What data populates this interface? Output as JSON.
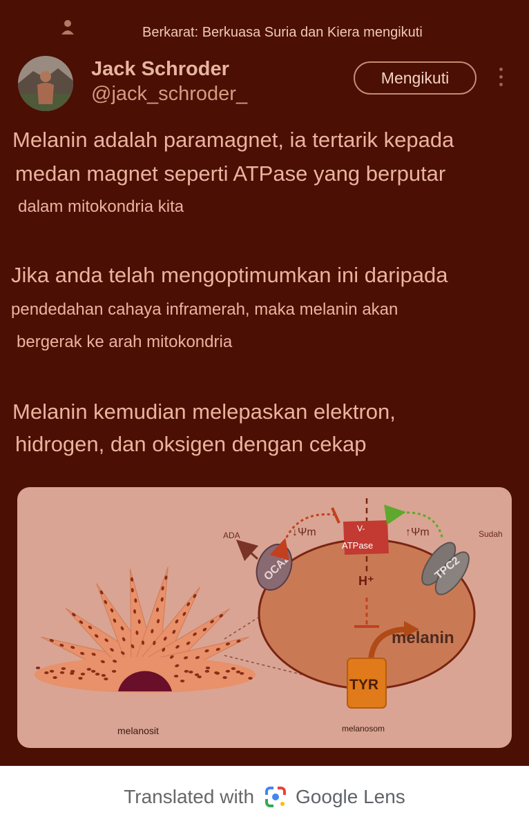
{
  "retweet": {
    "text": "Berkarat: Berkuasa Suria dan Kiera mengikuti"
  },
  "author": {
    "name": "Jack Schroder",
    "handle": "@jack_schroder_"
  },
  "follow_button": {
    "label": "Mengikuti"
  },
  "tweet": {
    "lines": [
      "Melanin adalah paramagnet, ia tertarik kepada",
      "medan magnet seperti ATPase yang berputar",
      "dalam mitokondria kita",
      "Jika anda telah mengoptimumkan ini daripada",
      "pendedahan cahaya inframerah, maka melanin akan",
      "bergerak ke arah mitokondria",
      "Melanin kemudian melepaskan elektron,",
      "hidrogen, dan oksigen dengan cekap"
    ]
  },
  "diagram": {
    "ada": "ADA",
    "sudah": "Sudah",
    "psi_left": "↓Ψm",
    "psi_right": "↑Ψm",
    "v_prefix": "V-",
    "atpase": "ATPase",
    "hplus": "H⁺",
    "oca2": "OCA2",
    "tpc2": "TPC2",
    "melanin": "melanin",
    "tyr": "TYR",
    "melanocyte_label": "melanosit",
    "melanosome_label": "melanosom"
  },
  "lens": {
    "prefix": "Translated with",
    "brand": "Google Lens"
  },
  "colors": {
    "background": "#4b0f03",
    "text": "#eab49f",
    "figure_bg": "#d9a493",
    "organelle": "#c97a55"
  },
  "icons": [
    "person-icon",
    "more-vertical-icon",
    "google-lens-icon"
  ]
}
